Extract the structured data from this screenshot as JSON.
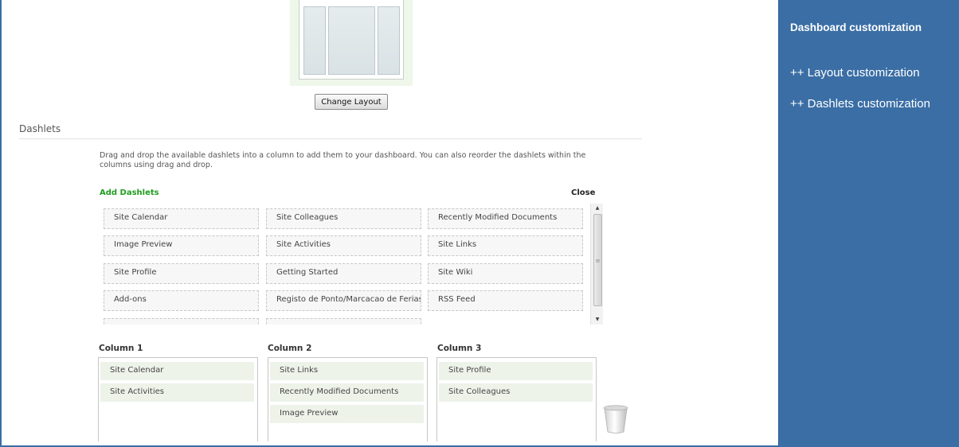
{
  "layout": {
    "change_button": "Change Layout"
  },
  "dashlets_section": {
    "title": "Dashlets",
    "instructions": "Drag and drop the available dashlets into a column to add them to your dashboard. You can also reorder the dashlets within the columns using drag and drop.",
    "add_label": "Add Dashlets",
    "close_label": "Close",
    "available": [
      "Site Calendar",
      "Site Colleagues",
      "Recently Modified Documents",
      "Image Preview",
      "Site Activities",
      "Site Links",
      "Site Profile",
      "Getting Started",
      "Site Wiki",
      "Add-ons",
      "Registo de Ponto/Marcacao de Ferias",
      "RSS Feed"
    ]
  },
  "columns": [
    {
      "title": "Column 1",
      "items": [
        "Site Calendar",
        "Site Activities"
      ]
    },
    {
      "title": "Column 2",
      "items": [
        "Site Links",
        "Recently Modified Documents",
        "Image Preview"
      ]
    },
    {
      "title": "Column 3",
      "items": [
        "Site Profile",
        "Site Colleagues"
      ]
    }
  ],
  "side_panel": {
    "title": "Dashboard customization",
    "links": [
      "++ Layout customization",
      "++ Dashlets customization"
    ]
  },
  "colors": {
    "panel_blue": "#3a6ea5",
    "add_green": "#1f9c1f",
    "column_item_bg": "#eef3ea"
  }
}
